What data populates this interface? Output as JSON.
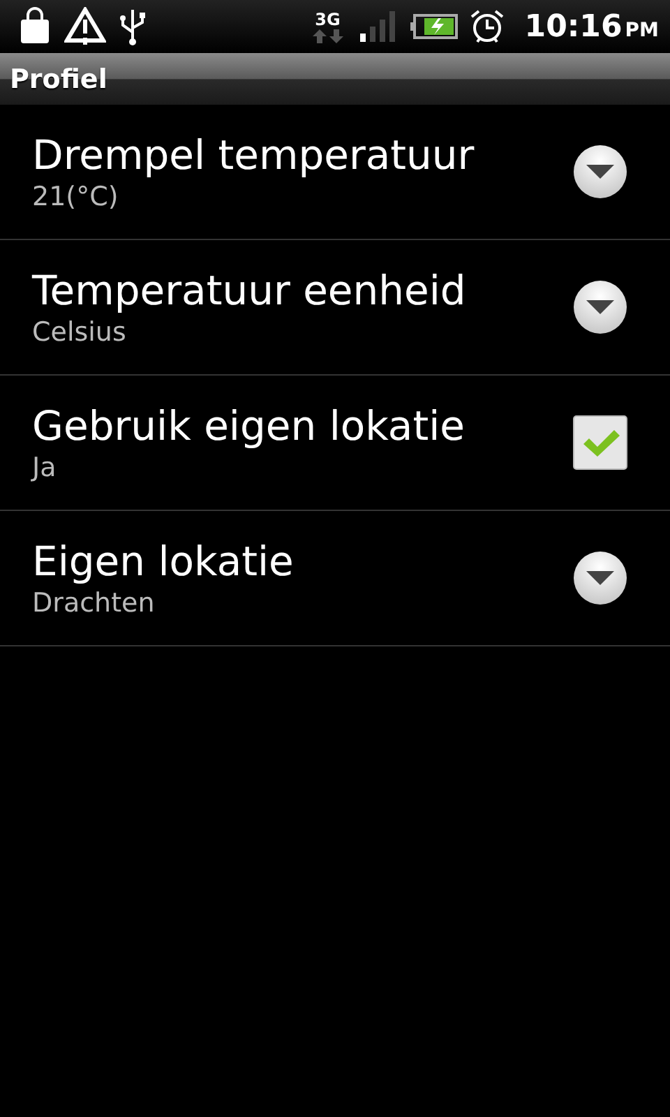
{
  "status_bar": {
    "network": "3G",
    "time": "10:16",
    "meridiem": "PM"
  },
  "title": "Profiel",
  "settings": [
    {
      "kind": "dropdown",
      "title": "Drempel temperatuur",
      "summary": "21(°C)"
    },
    {
      "kind": "dropdown",
      "title": "Temperatuur eenheid",
      "summary": "Celsius"
    },
    {
      "kind": "checkbox",
      "title": "Gebruik eigen lokatie",
      "summary": "Ja",
      "checked": true
    },
    {
      "kind": "dropdown",
      "title": "Eigen lokatie",
      "summary": "Drachten"
    }
  ]
}
